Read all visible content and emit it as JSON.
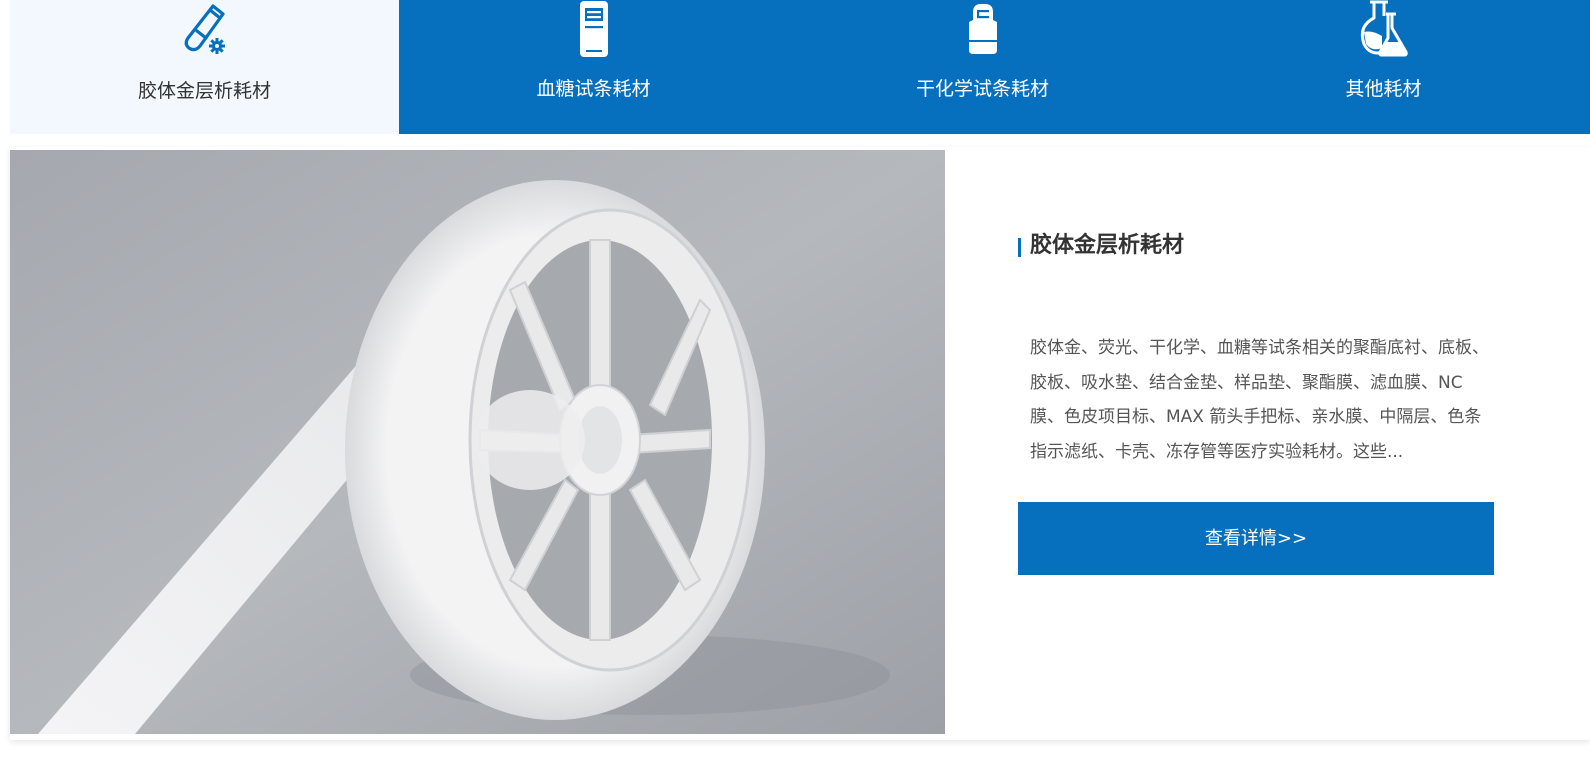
{
  "tabs": [
    {
      "label": "胶体金层析耗材",
      "icon": "test-tube-gear-icon",
      "active": true
    },
    {
      "label": "血糖试条耗材",
      "icon": "glucose-meter-icon",
      "active": false
    },
    {
      "label": "干化学试条耗材",
      "icon": "analyzer-device-icon",
      "active": false
    },
    {
      "label": "其他耗材",
      "icon": "lab-flasks-icon",
      "active": false
    }
  ],
  "detail": {
    "title": "胶体金层析耗材",
    "description": "胶体金、荧光、干化学、血糖等试条相关的聚酯底衬、底板、胶板、吸水垫、结合金垫、样品垫、聚酯膜、滤血膜、NC 膜、色皮项目标、MAX 箭头手把标、亲水膜、中隔层、色条指示滤纸、卡壳、冻存管等医疗实验耗材。这些...",
    "more_label": "查看详情>>",
    "image": "white-film-roll-on-reel-photo"
  },
  "colors": {
    "brand_blue": "#0770be",
    "active_tab_bg": "#f2f8fd",
    "text_dark": "#333333",
    "text_body": "#555555"
  }
}
